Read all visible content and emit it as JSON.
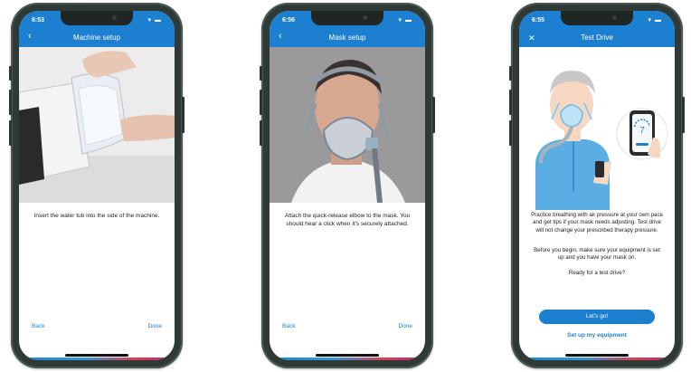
{
  "phones": [
    {
      "time": "6:53",
      "status_icons": "▾ ▬",
      "nav_icon": "‹",
      "title": "Machine setup",
      "instruction": "Insert the water tub into the side of the machine.",
      "back_label": "Back",
      "done_label": "Done"
    },
    {
      "time": "6:56",
      "status_icons": "▾ ▬",
      "nav_icon": "‹",
      "title": "Mask setup",
      "instruction": "Attach the quick-release elbow to the mask. You should hear a click when it's securely attached.",
      "back_label": "Back",
      "done_label": "Done"
    },
    {
      "time": "6:55",
      "status_icons": "▾ ▬",
      "nav_icon": "✕",
      "title": "Test Drive",
      "paragraph1": "Practice breathing with air pressure at your own pace and get tips if your mask needs adjusting. Test drive will not change your prescribed therapy pressure.",
      "paragraph2": "Before you begin, make sure your equipment is set up and you have your mask on.",
      "paragraph3": "Ready for a test drive?",
      "primary_button": "Let's go!",
      "secondary_link": "Set up my equipment",
      "device_reading": "7"
    }
  ],
  "colors": {
    "brand_blue": "#1c7fcf",
    "phone_frame": "#2f3a36"
  }
}
